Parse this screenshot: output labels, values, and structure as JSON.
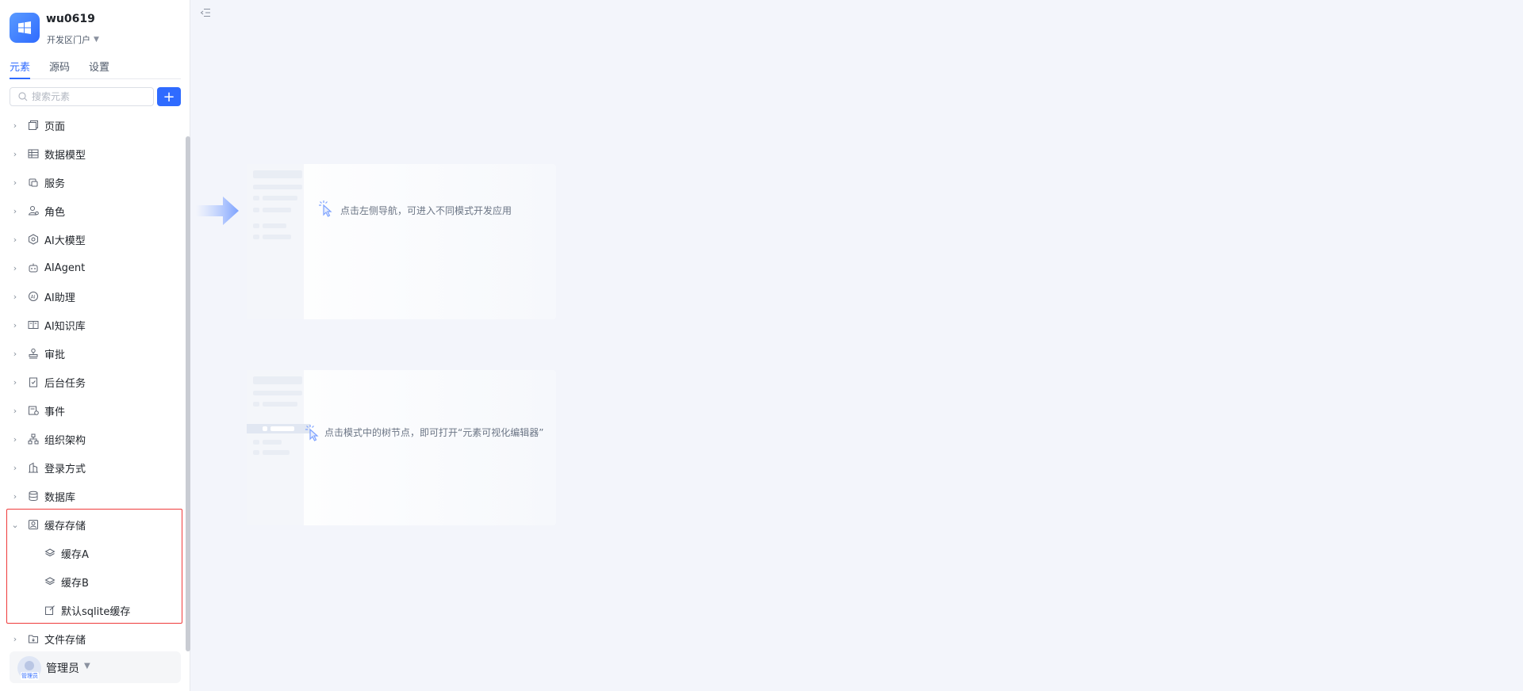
{
  "app": {
    "name": "wu0619",
    "portal": "开发区门户"
  },
  "tabs": [
    {
      "label": "元素",
      "active": true
    },
    {
      "label": "源码",
      "active": false
    },
    {
      "label": "设置",
      "active": false
    }
  ],
  "search": {
    "placeholder": "搜索元素"
  },
  "tree": {
    "items": [
      {
        "label": "页面",
        "icon": "page-icon"
      },
      {
        "label": "数据模型",
        "icon": "table-icon"
      },
      {
        "label": "服务",
        "icon": "service-icon"
      },
      {
        "label": "角色",
        "icon": "role-icon"
      },
      {
        "label": "AI大模型",
        "icon": "ai-model-icon"
      },
      {
        "label": "AIAgent",
        "icon": "robot-icon"
      },
      {
        "label": "AI助理",
        "icon": "ai-assistant-icon"
      },
      {
        "label": "AI知识库",
        "icon": "knowledge-base-icon"
      },
      {
        "label": "审批",
        "icon": "stamp-icon"
      },
      {
        "label": "后台任务",
        "icon": "task-icon"
      },
      {
        "label": "事件",
        "icon": "event-icon"
      },
      {
        "label": "组织架构",
        "icon": "org-chart-icon"
      },
      {
        "label": "登录方式",
        "icon": "login-icon"
      },
      {
        "label": "数据库",
        "icon": "database-icon"
      },
      {
        "label": "缓存存储",
        "icon": "cache-icon",
        "expanded": true
      },
      {
        "label": "文件存储",
        "icon": "folder-icon"
      }
    ],
    "cache_children": [
      {
        "label": "缓存A",
        "icon": "layers-icon"
      },
      {
        "label": "缓存B",
        "icon": "layers-icon"
      },
      {
        "label": "默认sqlite缓存",
        "icon": "edit-doc-icon"
      }
    ]
  },
  "user": {
    "name": "管理员",
    "avatar_tag": "管理员"
  },
  "main": {
    "hint1": "点击左侧导航，可进入不同模式开发应用",
    "hint2": "点击模式中的树节点，即可打开“元素可视化编辑器”"
  },
  "colors": {
    "accent": "#2f6bff",
    "highlight": "#ef3b3b",
    "background": "#f3f5fb"
  }
}
